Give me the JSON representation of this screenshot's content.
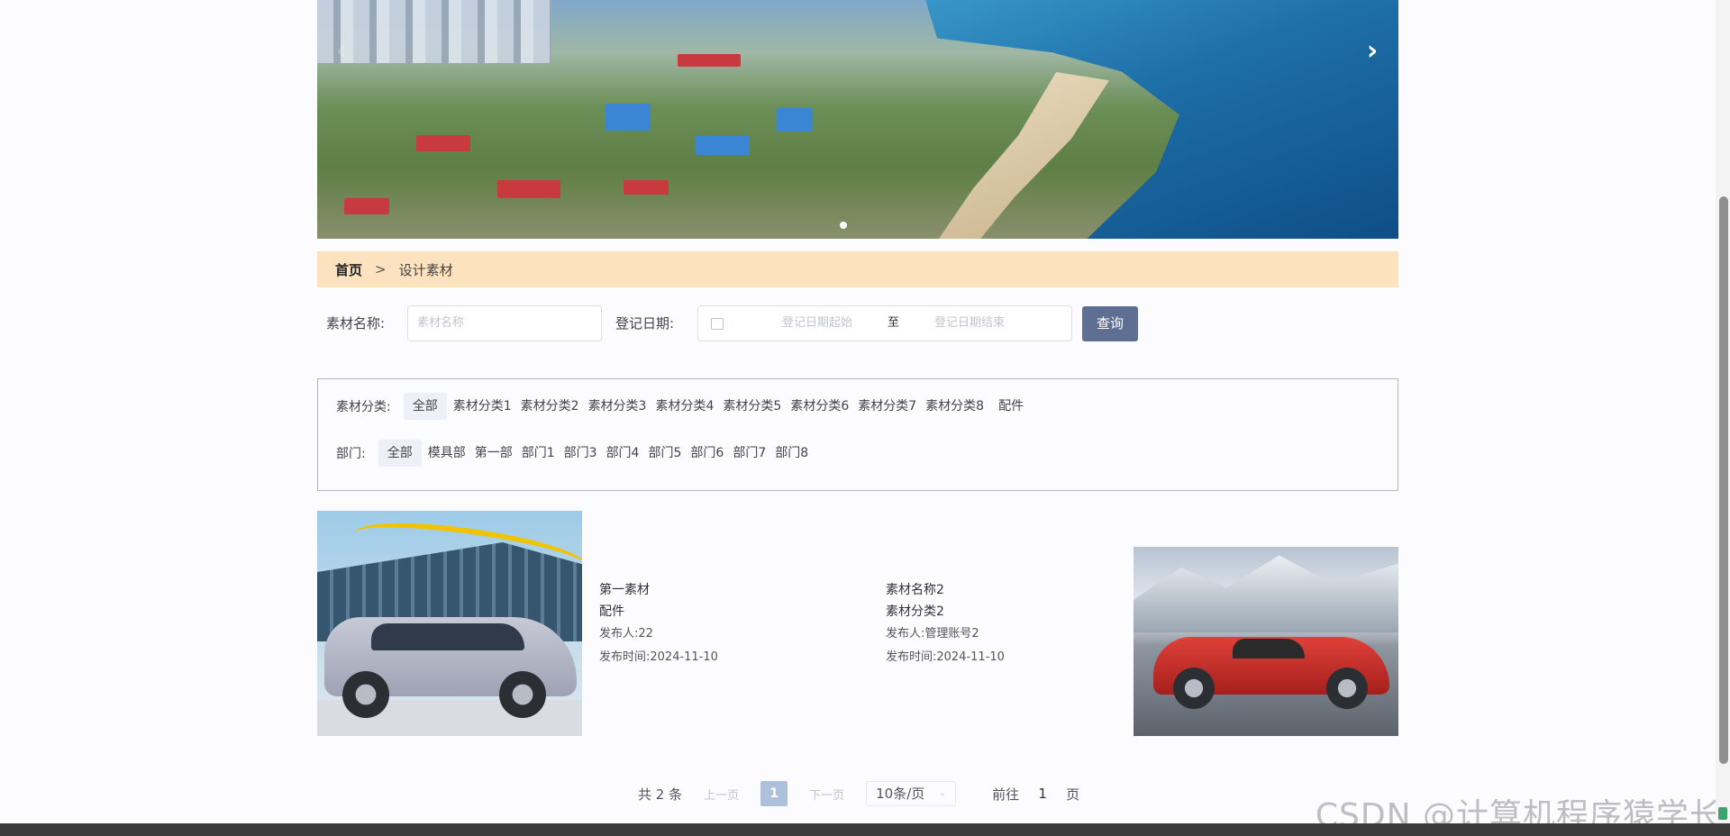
{
  "breadcrumb": {
    "home": "首页",
    "separator": ">",
    "current": "设计素材"
  },
  "search": {
    "name_label": "素材名称:",
    "name_placeholder": "素材名称",
    "date_label": "登记日期:",
    "date_start_placeholder": "登记日期起始",
    "date_to": "至",
    "date_end_placeholder": "登记日期结束",
    "query_button": "查询"
  },
  "filters": {
    "category": {
      "label": "素材分类:",
      "options": [
        "全部",
        "素材分类1",
        "素材分类2",
        "素材分类3",
        "素材分类4",
        "素材分类5",
        "素材分类6",
        "素材分类7",
        "素材分类8",
        "配件"
      ],
      "selected": "全部"
    },
    "department": {
      "label": "部门:",
      "options": [
        "全部",
        "模具部",
        "第一部",
        "部门1",
        "部门3",
        "部门4",
        "部门5",
        "部门6",
        "部门7",
        "部门8"
      ],
      "selected": "全部"
    }
  },
  "items": [
    {
      "title": "第一素材",
      "category": "配件",
      "publisher": "发布人:22",
      "publish_time": "发布时间:2024-11-10",
      "image_icon": "suv-car-image"
    },
    {
      "title": "素材名称2",
      "category": "素材分类2",
      "publisher": "发布人:管理账号2",
      "publish_time": "发布时间:2024-11-10",
      "image_icon": "red-sports-car-image"
    }
  ],
  "pagination": {
    "total": "共 2 条",
    "prev": "上一页",
    "current_page": "1",
    "next": "下一页",
    "page_size": "10条/页",
    "goto_label": "前往",
    "goto_value": "1",
    "goto_suffix": "页"
  },
  "watermark": "CSDN @计算机程序猿学长",
  "colors": {
    "breadcrumb_bg": "#fde2bf",
    "query_button": "#5e6f93",
    "active_page": "#adc1dc"
  }
}
